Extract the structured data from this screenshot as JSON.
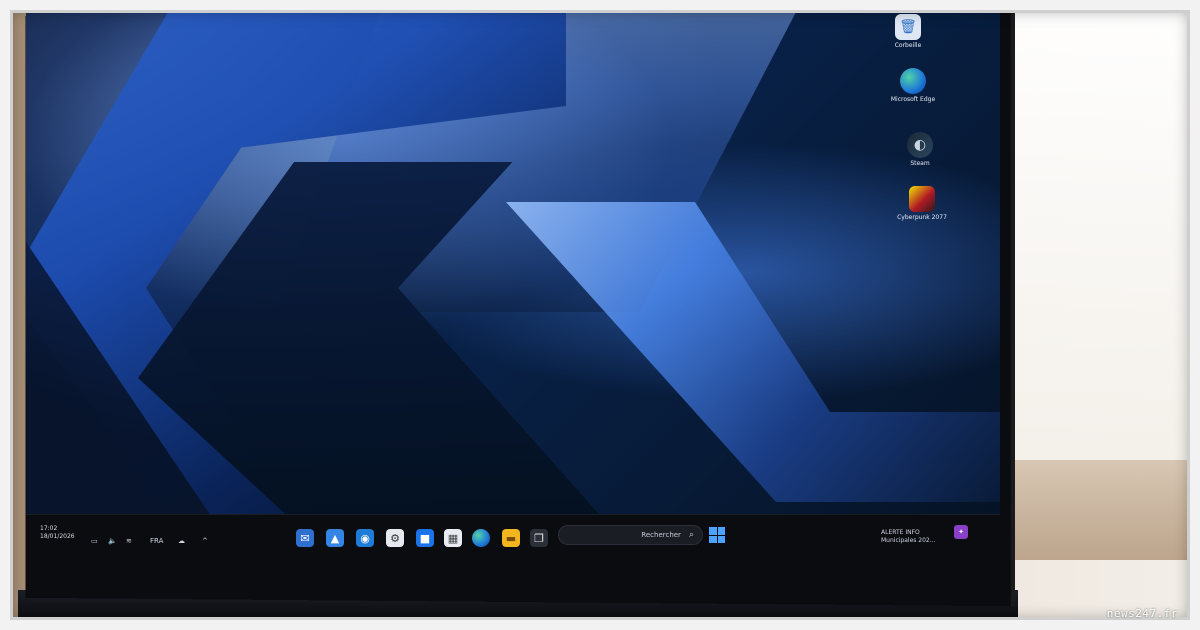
{
  "desktop": {
    "icons": [
      {
        "label": "Corbeille",
        "icon": "recycle-bin-icon"
      },
      {
        "label": "Microsoft Edge",
        "icon": "edge-icon"
      },
      {
        "label": "Steam",
        "icon": "steam-icon"
      },
      {
        "label": "Cyberpunk 2077",
        "icon": "cyberpunk-icon"
      }
    ]
  },
  "taskbar": {
    "clock_time": "17:02",
    "clock_date": "18/01/2026",
    "language": "FRA",
    "search_placeholder": "Rechercher",
    "notification_title": "ALERTE INFO",
    "notification_sub": "Municipales 202..."
  },
  "colors": {
    "wallpaper_accent": "#2f63c8",
    "taskbar_bg": "#0b0c10",
    "start_blue": "#4aa3ff"
  },
  "watermark": "news247.fr"
}
